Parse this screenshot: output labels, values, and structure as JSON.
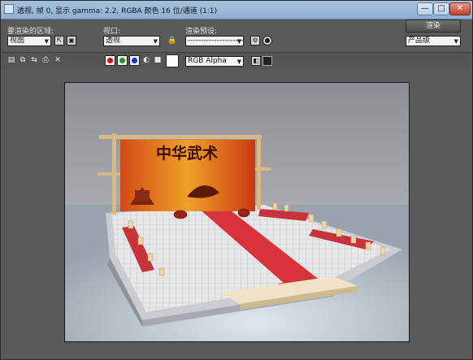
{
  "window": {
    "title": "透视, 帧 0, 显示 gamma: 2.2, RGBA 颜色 16 位/通道 (1:1)",
    "min_glyph": "—",
    "max_glyph": "□",
    "close_glyph": "✕"
  },
  "toolbar1": {
    "area_label": "要渲染的区域:",
    "area_value": "视图",
    "viewport_label": "视口:",
    "viewport_value": "透视",
    "preset_label": "渲染预设:",
    "preset_value": "-------------------------",
    "render_button": "渲染",
    "quality_value": "产品级"
  },
  "toolbar2": {
    "channel_value": "RGB Alpha"
  },
  "scene": {
    "banner_text": "中华武术"
  },
  "colors": {
    "red_channel": "#cc1010",
    "green_channel": "#109a20",
    "blue_channel": "#1530c8"
  }
}
